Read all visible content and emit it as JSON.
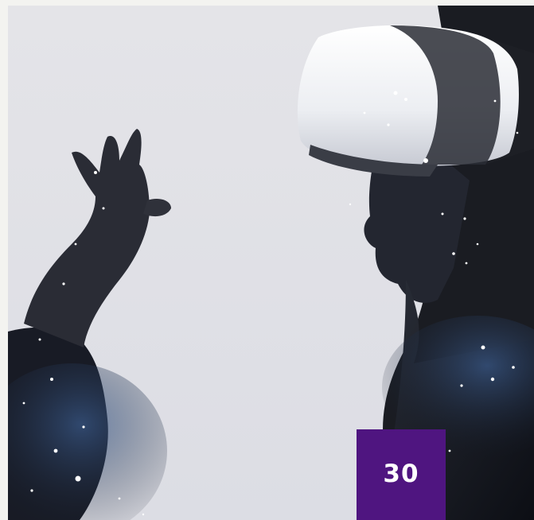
{
  "badge": {
    "value": "30",
    "color": "#4f1580"
  },
  "photo": {
    "background_color": "#e7e7eb",
    "subject_color": "#151821",
    "headset_color": "#f5f5f7"
  }
}
